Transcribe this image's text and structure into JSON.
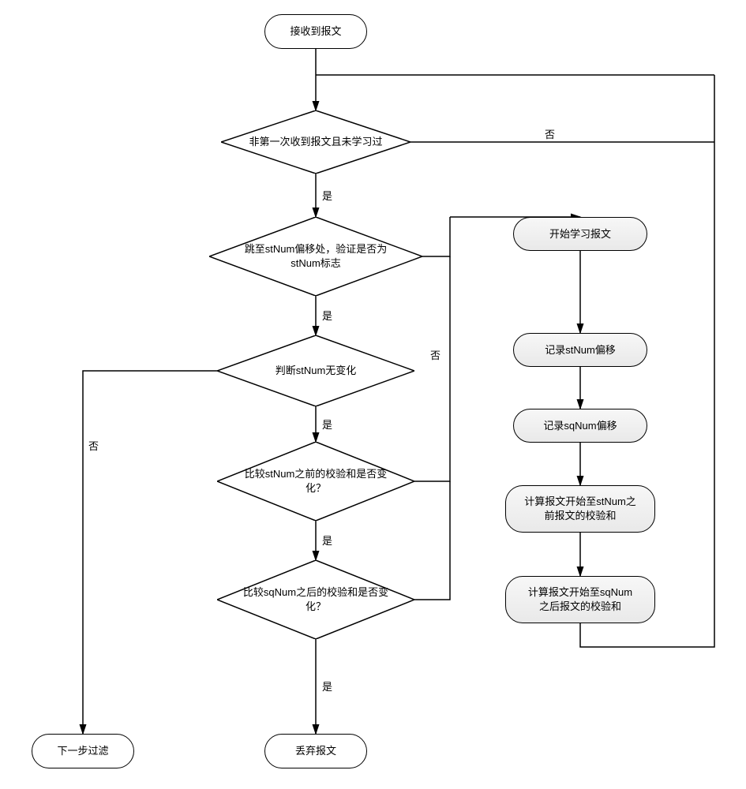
{
  "chart_data": {
    "type": "flowchart",
    "nodes": [
      {
        "id": "start",
        "kind": "terminator",
        "label": "接收到报文"
      },
      {
        "id": "d1",
        "kind": "decision",
        "label": "非第一次收到报文且未学习过"
      },
      {
        "id": "d2",
        "kind": "decision",
        "label": "跳至stNum偏移处，验证是否为stNum标志"
      },
      {
        "id": "d3",
        "kind": "decision",
        "label": "判断stNum无变化"
      },
      {
        "id": "d4",
        "kind": "decision",
        "label": "比较stNum之前的校验和是否变化？"
      },
      {
        "id": "d5",
        "kind": "decision",
        "label": "比较sqNum之后的校验和是否变化？"
      },
      {
        "id": "p1",
        "kind": "process",
        "label": "开始学习报文"
      },
      {
        "id": "p2",
        "kind": "process",
        "label": "记录stNum偏移"
      },
      {
        "id": "p3",
        "kind": "process",
        "label": "记录sqNum偏移"
      },
      {
        "id": "p4",
        "kind": "process",
        "label": "计算报文开始至stNum之前报文的校验和"
      },
      {
        "id": "p5",
        "kind": "process",
        "label": "计算报文开始至sqNum之后报文的校验和"
      },
      {
        "id": "endNext",
        "kind": "terminator",
        "label": "下一步过滤"
      },
      {
        "id": "endDrop",
        "kind": "terminator",
        "label": "丢弃报文"
      }
    ],
    "edges": [
      {
        "from": "start",
        "to": "d1"
      },
      {
        "from": "d1",
        "to": "d2",
        "label": "是"
      },
      {
        "from": "d1",
        "to": "p1",
        "label": "否"
      },
      {
        "from": "d2",
        "to": "d3",
        "label": "是"
      },
      {
        "from": "d2",
        "to": "p1",
        "label": "否"
      },
      {
        "from": "d3",
        "to": "d4",
        "label": "是"
      },
      {
        "from": "d3",
        "to": "endNext",
        "label": "否"
      },
      {
        "from": "d4",
        "to": "d5",
        "label": "是"
      },
      {
        "from": "d4",
        "to": "p1",
        "label": "否"
      },
      {
        "from": "d5",
        "to": "endDrop",
        "label": "是"
      },
      {
        "from": "d5",
        "to": "p1",
        "label": "否"
      },
      {
        "from": "p1",
        "to": "p2"
      },
      {
        "from": "p2",
        "to": "p3"
      },
      {
        "from": "p3",
        "to": "p4"
      },
      {
        "from": "p4",
        "to": "p5"
      },
      {
        "from": "p5",
        "to": "d1"
      }
    ]
  },
  "labels": {
    "start": "接收到报文",
    "d1": "非第一次收到报文且未学习过",
    "d2": "跳至stNum偏移处，验证是否为\nstNum标志",
    "d3": "判断stNum无变化",
    "d4": "比较stNum之前的校验和是否变\n化？",
    "d5": "比较sqNum之后的校验和是否变\n化？",
    "p1": "开始学习报文",
    "p2": "记录stNum偏移",
    "p3": "记录sqNum偏移",
    "p4": "计算报文开始至stNum之\n前报文的校验和",
    "p5": "计算报文开始至sqNum\n之后报文的校验和",
    "endNext": "下一步过滤",
    "endDrop": "丢弃报文",
    "yes": "是",
    "no": "否"
  }
}
